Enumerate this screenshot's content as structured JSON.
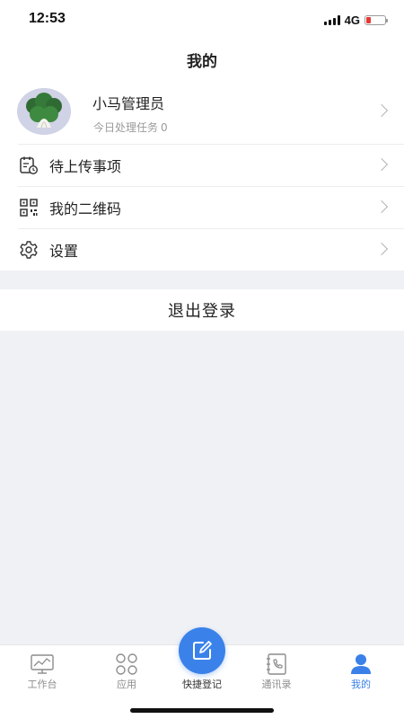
{
  "status_bar": {
    "time": "12:53",
    "network": "4G",
    "battery_color": "#e53935"
  },
  "header": {
    "title": "我的"
  },
  "profile": {
    "name": "小马管理员",
    "tasks_label": "今日处理任务",
    "tasks_count": "0",
    "avatar_icon": "vegetable-avatar"
  },
  "menu": [
    {
      "label": "待上传事项",
      "icon": "pending-upload-icon"
    },
    {
      "label": "我的二维码",
      "icon": "qrcode-icon"
    },
    {
      "label": "设置",
      "icon": "settings-icon"
    }
  ],
  "logout": {
    "label": "退出登录"
  },
  "tabbar": {
    "accent_color": "#3b80e8",
    "tabs": [
      {
        "label": "工作台",
        "icon": "dashboard-icon"
      },
      {
        "label": "应用",
        "icon": "apps-icon"
      },
      {
        "label": "快捷登记",
        "icon": "quick-register-icon"
      },
      {
        "label": "通讯录",
        "icon": "contacts-icon"
      },
      {
        "label": "我的",
        "icon": "profile-icon",
        "active": true
      }
    ]
  }
}
